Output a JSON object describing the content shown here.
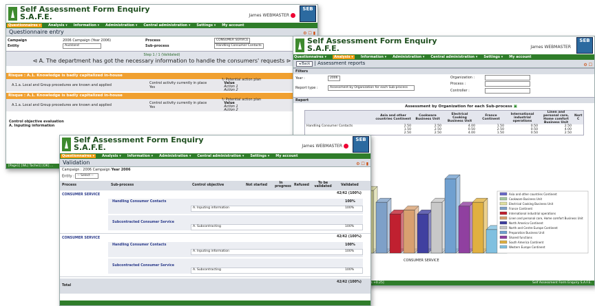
{
  "app": {
    "title_line1": "Self Assessment Form Enquiry",
    "title_line2": "S.A.F.E.",
    "user": "James WEBMASTER",
    "logo_text": "SEB"
  },
  "menu": [
    "Questionnaires ▾",
    "Analysis ▾",
    "Information ▾",
    "Administration ▾",
    "Central administration ▾",
    "Settings ▾",
    "My account"
  ],
  "w1": {
    "page_title": "Questionnaire entry",
    "campaign_label": "Campaign",
    "campaign_value": "2006 Campaign (Year 2006)",
    "process_label": "Process",
    "process_value": "CONSUMER SERVICE",
    "entity_label": "Entity",
    "entity_value": "Auckland",
    "subprocess_label": "Sub-process",
    "subprocess_value": "Handling Consumer Contacts",
    "step": "Step 1 / 1 (Validated)",
    "question": "A. The department has got the necessary information to handle the consumers' requests",
    "risk1": "Risque : A.1. Knowledge is badly capitalized in-house",
    "ctrl": "A.1.a. Local and Group procedures are known and applied",
    "ctrl_place": "Control activity currently in place",
    "yes": "Yes",
    "plan": "Potential action plan",
    "plan_value": "Value",
    "action1": "Action 1",
    "action2": "Action 2",
    "risk2": "Risque : A.1. Knowledge is badly capitalized in-house",
    "obj_eval": "Control objective evaluation",
    "obj_a": "A. Inputing information",
    "status": "[Page1] [WL] Tache1] [OK] ..."
  },
  "w2": {
    "back": "◂ Back",
    "page_title": "Assessment reports",
    "filters": "Filters",
    "year_label": "Year :",
    "year_value": "2006",
    "org_label": "Organization :",
    "process_label": "Process :",
    "controller_label": "Controller :",
    "rtype_label": "Report type :",
    "rtype_value": "Assessment by Organization for each Sub-process",
    "report": "Report",
    "table_title": "Assessment by Organization for each Sub-process",
    "columns": [
      "Asia and other countries Continent",
      "Cookware Business Unit",
      "Electrical Cooking Business Unit",
      "France Continent",
      "International industrial operations",
      "Linen and personal care, Home comfort Business Unit",
      "Nort C"
    ],
    "rows": [
      {
        "name": "Handling Consumer Contacts",
        "values": [
          "2.50",
          "2.50",
          "4.00",
          "1.50",
          "0.50",
          "2.50"
        ]
      },
      {
        "name": "",
        "values": [
          "1.50",
          "2.50",
          "0.50",
          "2.50",
          "0.50",
          "4.00"
        ]
      },
      {
        "name": "",
        "values": [
          "2.50",
          "2.50",
          "4.00",
          "1.50",
          "0.50",
          "2.50"
        ]
      }
    ],
    "chart_xlabel": "CONSUMER SERVICE",
    "status_left": "[Preferences] [?] [Blog] [?] [8] [-->] [0.14s - 0.02s +0.25]",
    "status_right": "Self Assessment Form Enquiry S.A.F.E."
  },
  "chart_data": {
    "type": "bar",
    "categories": [
      "CONSUMER SERVICE"
    ],
    "series": [
      {
        "name": "Asia and other countries Continent",
        "values": [
          3.0
        ]
      },
      {
        "name": "Cookware Business Unit",
        "values": [
          4.6
        ]
      },
      {
        "name": "Electrical Cooking Business Unit",
        "values": [
          3.2
        ]
      },
      {
        "name": "France Continent",
        "values": [
          2.6
        ]
      },
      {
        "name": "International industrial operations",
        "values": [
          2.0
        ]
      },
      {
        "name": "Linen and personal care, Home comfort Business Unit",
        "values": [
          2.2
        ]
      },
      {
        "name": "North America Continent",
        "values": [
          2.0
        ]
      },
      {
        "name": "North and Centre Europe Continent",
        "values": [
          2.6
        ]
      },
      {
        "name": "Preparation Business Unit",
        "values": [
          3.8
        ]
      },
      {
        "name": "Shared functions",
        "values": [
          2.4
        ]
      },
      {
        "name": "South America Continent",
        "values": [
          2.6
        ]
      },
      {
        "name": "Western Europe Continent",
        "values": [
          1.2
        ]
      }
    ],
    "colors": [
      "#6b6bc8",
      "#a6c8a0",
      "#e0e0a0",
      "#7ea0c8",
      "#c02030",
      "#d8a070",
      "#4040a0",
      "#c8c8c8",
      "#70a0d0",
      "#9040a0",
      "#e0b040",
      "#80c0e0"
    ],
    "ylim": [
      0,
      5
    ]
  },
  "w3": {
    "page_title": "Validation",
    "campaign_line": "Campaign : 2006 Campaign",
    "campaign_year": "Year 2006",
    "entity_label": "Entity :",
    "entity_value": "-- Select --",
    "headers": [
      "Process",
      "Sub-process",
      "Control objective",
      "Not started",
      "In progress",
      "Refused",
      "To be validated",
      "Validated"
    ],
    "groups": [
      {
        "process": "CONSUMER SERVICE",
        "total": "42/42 (100%)",
        "subs": [
          {
            "name": "Handling Consumer Contacts",
            "pct": "100%",
            "objs": [
              {
                "name": "A. Inputing information",
                "pct": "100%"
              }
            ]
          },
          {
            "name": "Subcontracted Consumer Service",
            "pct": "100%",
            "objs": [
              {
                "name": "A. Subcontracting",
                "pct": "100%"
              }
            ]
          }
        ]
      },
      {
        "process": "CONSUMER SERVICE",
        "total": "42/42 (100%)",
        "subs": [
          {
            "name": "Handling Consumer Contacts",
            "pct": "100%",
            "objs": [
              {
                "name": "A. Inputing information",
                "pct": "100%"
              }
            ]
          },
          {
            "name": "Subcontracted Consumer Service",
            "pct": "100%",
            "objs": [
              {
                "name": "A. Subcontracting",
                "pct": "100%"
              }
            ]
          }
        ]
      }
    ],
    "total_label": "Total",
    "total_value": "42/42 (100%)"
  }
}
